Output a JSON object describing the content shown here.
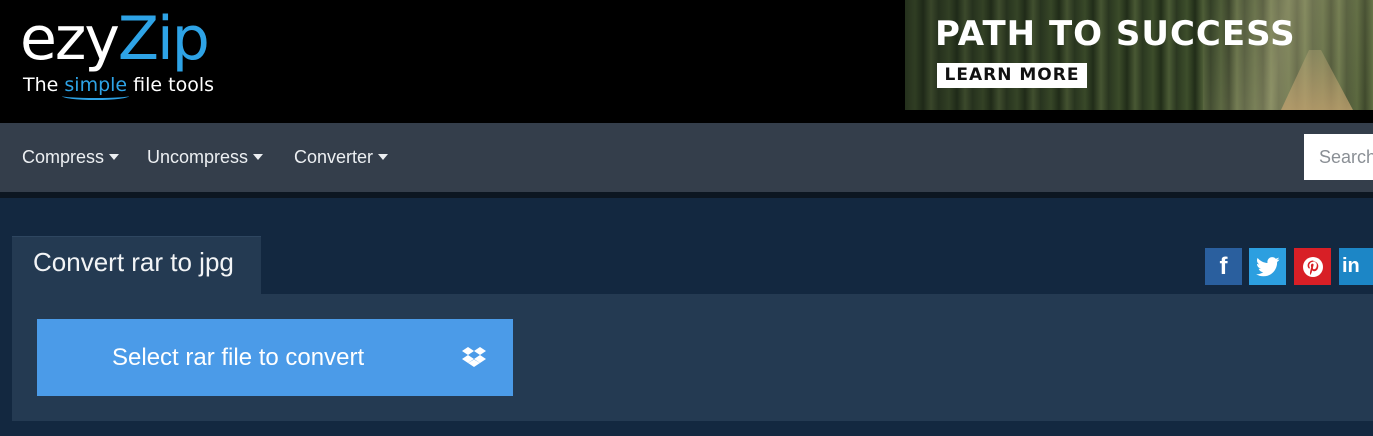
{
  "logo": {
    "brand_part1": "ezy",
    "brand_part2": "Zip",
    "tagline_prefix": "The ",
    "tagline_highlight": "simple",
    "tagline_suffix": " file tools"
  },
  "ad": {
    "headline": "PATH TO SUCCESS",
    "cta": "LEARN MORE"
  },
  "nav": {
    "items": [
      {
        "label": "Compress"
      },
      {
        "label": "Uncompress"
      },
      {
        "label": "Converter"
      }
    ],
    "search_placeholder": "Search"
  },
  "converter": {
    "tab_title": "Convert rar to jpg",
    "select_button_label": "Select rar file to convert"
  },
  "social": {
    "facebook_glyph": "f",
    "linkedin_glyph": "in"
  },
  "colors": {
    "brand_blue": "#2ea3e6",
    "select_button": "#4b9be8",
    "navbar": "#343e4b",
    "panel": "#243a52",
    "page_bg": "#132840",
    "facebook": "#2a5f9e",
    "twitter": "#2c9fe0",
    "pinterest": "#d81f26",
    "linkedin": "#1c86c6"
  }
}
